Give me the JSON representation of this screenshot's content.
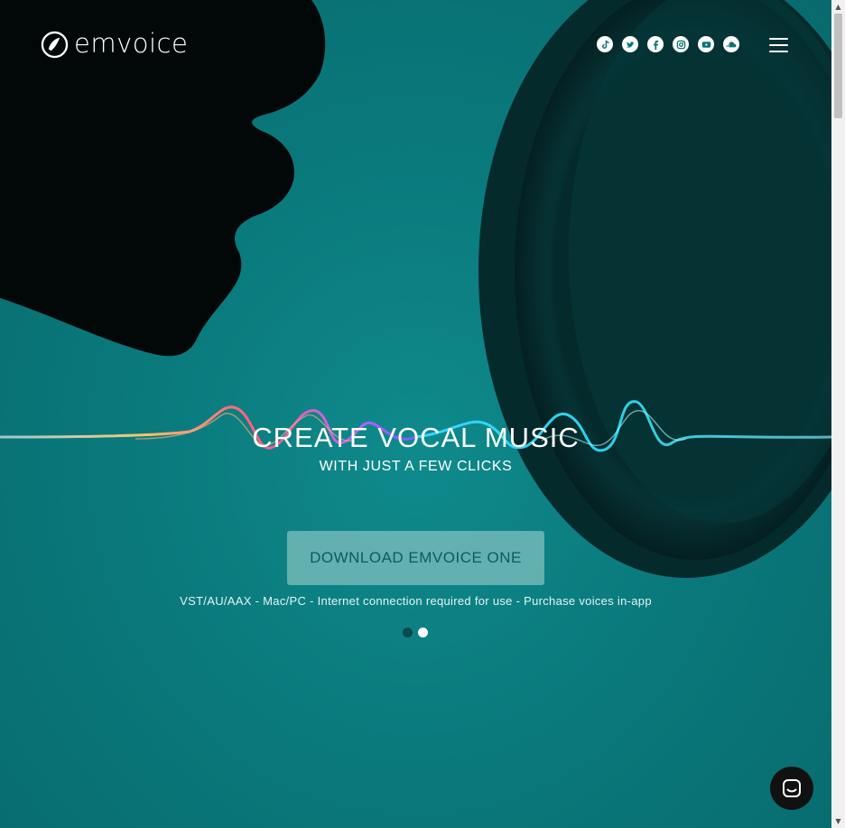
{
  "brand": {
    "name": "emvoice"
  },
  "social": [
    {
      "icon": "tiktok-icon"
    },
    {
      "icon": "twitter-icon"
    },
    {
      "icon": "facebook-icon"
    },
    {
      "icon": "instagram-icon"
    },
    {
      "icon": "youtube-icon"
    },
    {
      "icon": "soundcloud-icon"
    }
  ],
  "hero": {
    "headline": "CREATE VOCAL MUSIC",
    "subheadline": "WITH JUST A FEW CLICKS",
    "cta_label": "DOWNLOAD EMVOICE ONE",
    "note": "VST/AU/AAX - Mac/PC - Internet connection required for use - Purchase voices in-app"
  },
  "carousel": {
    "slides": 2,
    "active_slide": 2
  },
  "colors": {
    "background": "#087477",
    "cta": "#aad7d4",
    "chat_button": "#111111"
  }
}
